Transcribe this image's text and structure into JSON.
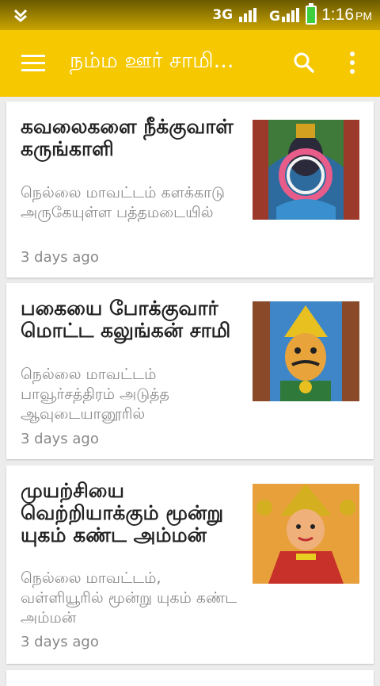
{
  "status_bar": {
    "network_label": "3G",
    "time": "1:16",
    "ampm": "PM"
  },
  "toolbar": {
    "title": "நம்ம ஊர் சாமி..."
  },
  "articles": [
    {
      "headline": "கவலைகளை நீக்குவாள் கருங்காளி",
      "summary": "நெல்லை மாவட்டம் களக்காடு அருகேயுள்ள பத்தமடையில்",
      "time": "3 days ago"
    },
    {
      "headline": "பகையை போக்குவார் மொட்ட கலுங்கன் சாமி",
      "summary": "நெல்லை மாவட்டம் பாவூர்சத்திரம் அடுத்த ஆவுடையானூரில்",
      "time": "3 days ago"
    },
    {
      "headline": "முயற்சியை வெற்றியாக்கும் மூன்று யுகம் கண்ட அம்மன்",
      "summary": "நெல்லை மாவட்டம், வள்ளியூரில் மூன்று யுகம் கண்ட அம்மன்",
      "time": "3 days ago"
    }
  ]
}
